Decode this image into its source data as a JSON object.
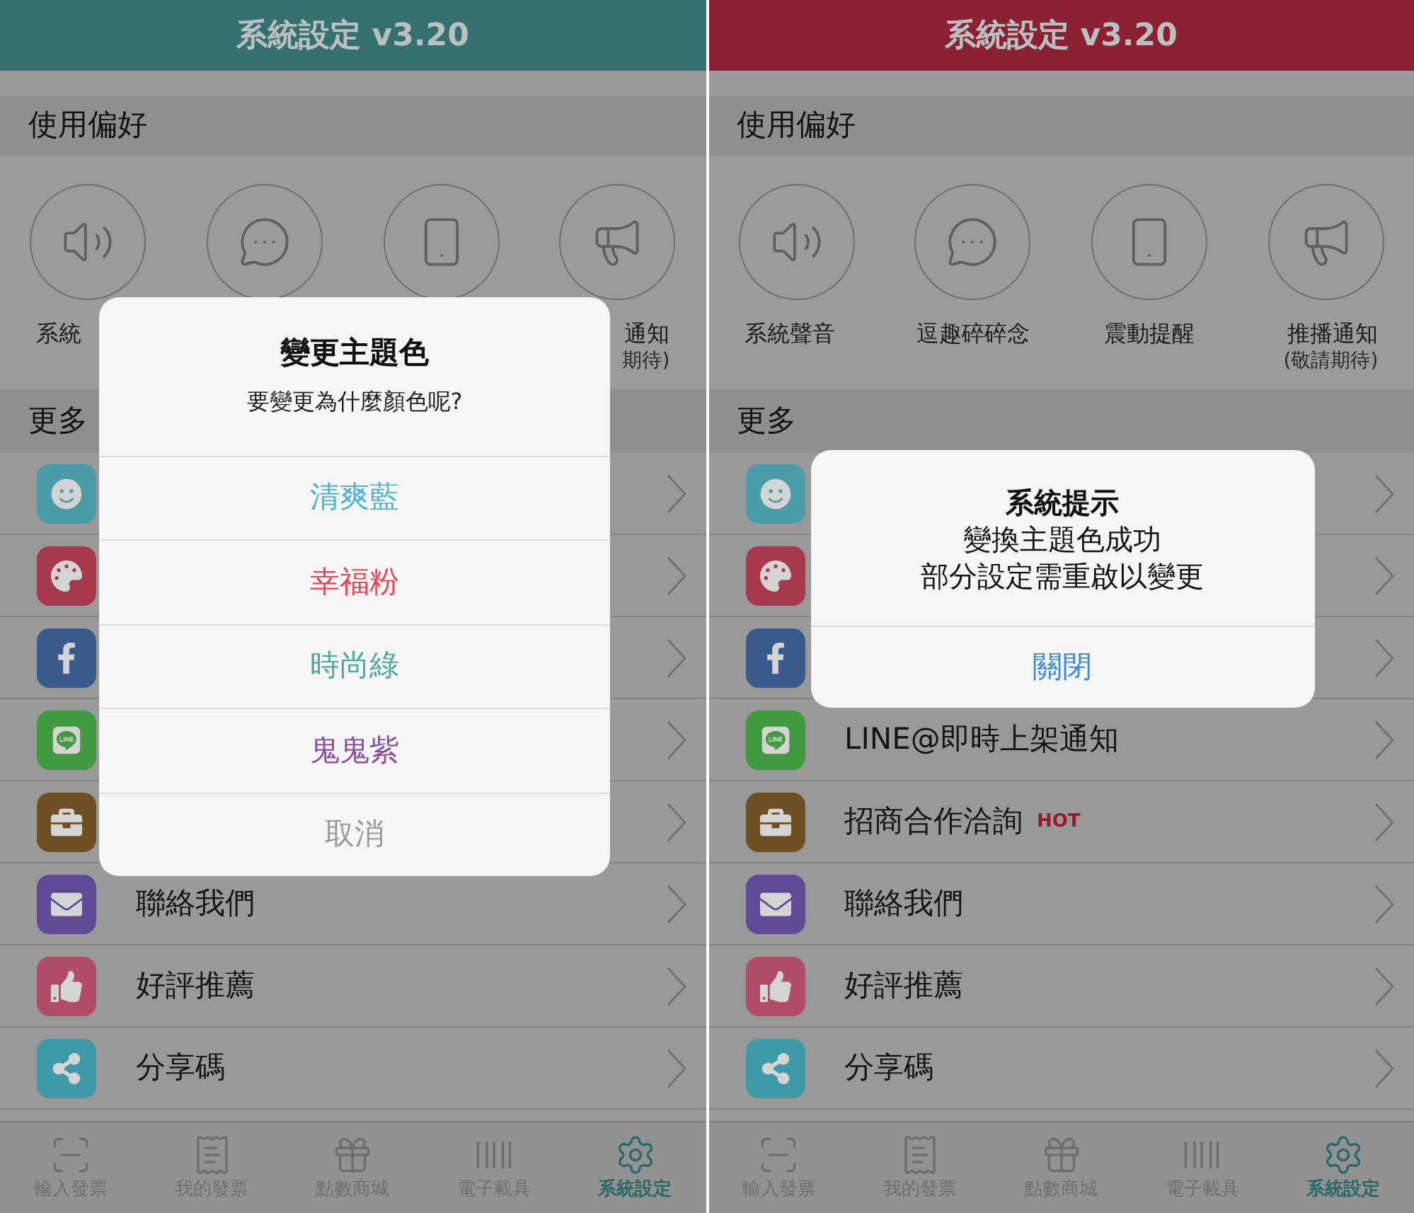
{
  "panels": [
    {
      "header": {
        "title": "系統設定 v3.20",
        "color": "#356f70"
      },
      "sections": [
        {
          "title": "使用偏好"
        },
        {
          "title": "更多"
        }
      ],
      "preferences": [
        {
          "kind": "circle_button",
          "label": "系統"
        },
        {
          "kind": "circle_button"
        },
        {
          "kind": "circle_button"
        },
        {
          "kind": "circle_button",
          "label": "通知",
          "note": "期待)"
        }
      ],
      "rows": [
        {
          "color": "#4a9ca8"
        },
        {
          "color": "#a63a4c"
        },
        {
          "color": "#395b8c"
        },
        {
          "color": "#3f9a40"
        },
        {
          "color": "#6f4f24"
        },
        {
          "color": "#5f4b95",
          "label": "聯絡我們"
        },
        {
          "color": "#b04c66",
          "label": "好評推薦"
        },
        {
          "color": "#3d9aa6",
          "label": "分享碼"
        }
      ],
      "dialog": {
        "kind": "picker",
        "title": "變更主題色",
        "message": "要變更為什麼顏色呢?",
        "options": [
          {
            "label": "清爽藍",
            "color": "#4bb3d6"
          },
          {
            "label": "幸福粉",
            "color": "#e84550"
          },
          {
            "label": "時尚綠",
            "color": "#4aa9a2"
          },
          {
            "label": "鬼鬼紫",
            "color": "#8a4f9e"
          },
          {
            "label": "取消",
            "color": "#9a9a9a"
          }
        ]
      },
      "tabs": [
        {
          "label": "輸入發票",
          "selected": false
        },
        {
          "label": "我的發票",
          "selected": false
        },
        {
          "label": "點數商城",
          "selected": false
        },
        {
          "label": "電子載具",
          "selected": false
        },
        {
          "label": "系統設定",
          "selected": true
        }
      ]
    },
    {
      "header": {
        "title": "系統設定 v3.20",
        "color": "#8b2130"
      },
      "sections": [
        {
          "title": "使用偏好"
        },
        {
          "title": "更多"
        }
      ],
      "preferences": [
        {
          "kind": "circle_button",
          "label": "系統聲音"
        },
        {
          "kind": "circle_button",
          "label": "逗趣碎碎念"
        },
        {
          "kind": "circle_button",
          "label": "震動提醒"
        },
        {
          "kind": "circle_button",
          "label": "推播通知",
          "note": "(敬請期待)"
        }
      ],
      "rows": [
        {
          "color": "#4a9ca8"
        },
        {
          "color": "#a63a4c"
        },
        {
          "color": "#395b8c"
        },
        {
          "color": "#3f9a40",
          "label": "LINE@即時上架通知"
        },
        {
          "color": "#6f4f24",
          "label": "招商合作洽詢",
          "badge": "HOT"
        },
        {
          "color": "#5f4b95",
          "label": "聯絡我們"
        },
        {
          "color": "#b04c66",
          "label": "好評推薦"
        },
        {
          "color": "#3d9aa6",
          "label": "分享碼"
        }
      ],
      "dialog": {
        "kind": "alert",
        "title": "系統提示",
        "message": "變換主題色成功",
        "message2": "部分設定需重啟以變更",
        "options": [
          {
            "label": "關閉",
            "color": "#3d88e0"
          }
        ]
      },
      "tabs": [
        {
          "label": "輸入發票",
          "selected": false
        },
        {
          "label": "我的發票",
          "selected": false
        },
        {
          "label": "點數商城",
          "selected": false
        },
        {
          "label": "電子載具",
          "selected": false
        },
        {
          "label": "系統設定",
          "selected": true
        }
      ]
    }
  ]
}
